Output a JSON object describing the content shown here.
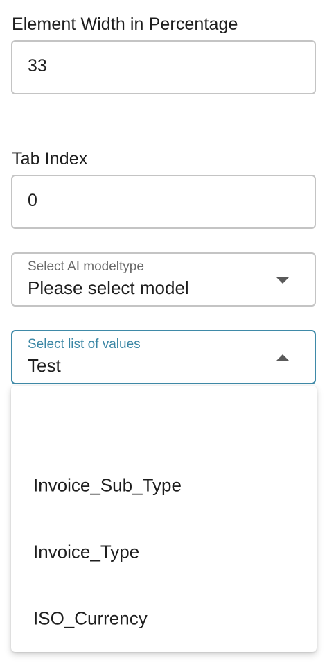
{
  "width_field": {
    "label": "Element Width in Percentage",
    "value": "33"
  },
  "tab_index_field": {
    "label": "Tab Index",
    "value": "0"
  },
  "ai_model_select": {
    "label": "Select AI modeltype",
    "value": "Please select model",
    "icon": "chevron-down-icon"
  },
  "list_values_select": {
    "label": "Select list of values",
    "value": "Test",
    "icon": "chevron-up-icon",
    "accent_color": "#3a86a4"
  },
  "dropdown": {
    "options": [
      {
        "label": ""
      },
      {
        "label": "Invoice_Sub_Type"
      },
      {
        "label": "Invoice_Type"
      },
      {
        "label": "ISO_Currency"
      }
    ]
  }
}
